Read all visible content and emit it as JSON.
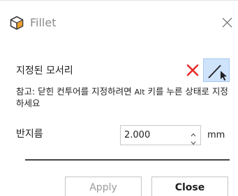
{
  "dialog": {
    "title": "Fillet",
    "title_icon": "fillet-cube-icon",
    "close_icon": "close-icon"
  },
  "selection": {
    "label": "지정된 모서리",
    "clear_icon": "red-x-icon",
    "pick_icon": "edge-pick-cursor-icon"
  },
  "hint": {
    "prefix": "참고: 닫힌 컨투어를 지정하려면 ",
    "key": "Alt",
    "suffix": " 키를 누른 상태로 지정하세요"
  },
  "radius": {
    "label": "반지름",
    "value": "2.000",
    "unit": "mm",
    "up_icon": "spin-up-icon",
    "down_icon": "spin-down-icon"
  },
  "buttons": {
    "apply": "Apply",
    "close": "Close"
  },
  "colors": {
    "clear_red": "#e52b2b",
    "pick_bg": "#cfe3fb"
  }
}
